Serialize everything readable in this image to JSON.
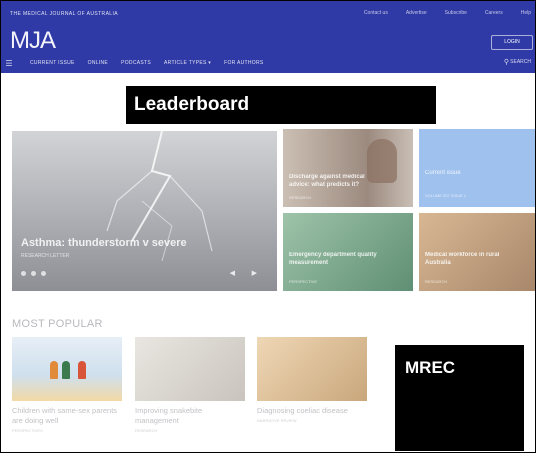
{
  "header": {
    "publisher": "THE MEDICAL JOURNAL OF AUSTRALIA",
    "brand": "MJA",
    "top_links": [
      "Contact us",
      "Advertise",
      "Subscribe",
      "Careers",
      "Help"
    ],
    "login_label": "LOGIN",
    "nav_items": [
      "CURRENT ISSUE",
      "ONLINE",
      "PODCASTS",
      "ARTICLE TYPES ▾",
      "FOR AUTHORS"
    ],
    "search_label": "SEARCH"
  },
  "ads": {
    "leaderboard": "Leaderboard",
    "mrec": "MREC"
  },
  "hero": {
    "title": "Asthma: thunderstorm v severe",
    "meta": "RESEARCH LETTER"
  },
  "tiles": [
    {
      "title": "Discharge against medical advice: what predicts it?",
      "meta": "RESEARCH"
    },
    {
      "title": "Current issue",
      "meta": "VOLUME 207 ISSUE 1"
    },
    {
      "title": "Emergency department quality measurement",
      "meta": "PERSPECTIVE"
    },
    {
      "title": "Medical workforce in rural Australia",
      "meta": "RESEARCH"
    }
  ],
  "most_popular": {
    "heading": "MOST POPULAR",
    "cards": [
      {
        "title": "Children with same-sex parents are doing well",
        "meta": "PERSPECTIVES"
      },
      {
        "title": "Improving snakebite management",
        "meta": "RESEARCH"
      },
      {
        "title": "Diagnosing coeliac disease",
        "meta": "NARRATIVE REVIEW"
      }
    ]
  },
  "icons": {
    "menu": "menu-icon",
    "search": "search-icon",
    "prev": "chevron-left-icon",
    "next": "chevron-right-icon"
  },
  "colors": {
    "header_bg": "#2f3aa6",
    "ad_bg": "#000000",
    "ad_text": "#ffffff"
  }
}
